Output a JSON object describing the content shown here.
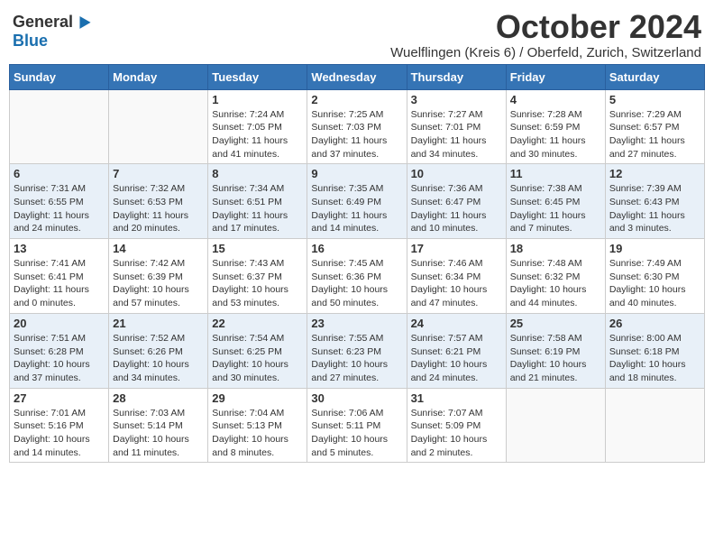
{
  "header": {
    "logo": {
      "general": "General",
      "blue": "Blue"
    },
    "title": "October 2024",
    "subtitle": "Wuelflingen (Kreis 6) / Oberfeld, Zurich, Switzerland"
  },
  "days_of_week": [
    "Sunday",
    "Monday",
    "Tuesday",
    "Wednesday",
    "Thursday",
    "Friday",
    "Saturday"
  ],
  "weeks": [
    [
      {
        "day": null
      },
      {
        "day": null
      },
      {
        "day": "1",
        "sunrise": "Sunrise: 7:24 AM",
        "sunset": "Sunset: 7:05 PM",
        "daylight": "Daylight: 11 hours and 41 minutes."
      },
      {
        "day": "2",
        "sunrise": "Sunrise: 7:25 AM",
        "sunset": "Sunset: 7:03 PM",
        "daylight": "Daylight: 11 hours and 37 minutes."
      },
      {
        "day": "3",
        "sunrise": "Sunrise: 7:27 AM",
        "sunset": "Sunset: 7:01 PM",
        "daylight": "Daylight: 11 hours and 34 minutes."
      },
      {
        "day": "4",
        "sunrise": "Sunrise: 7:28 AM",
        "sunset": "Sunset: 6:59 PM",
        "daylight": "Daylight: 11 hours and 30 minutes."
      },
      {
        "day": "5",
        "sunrise": "Sunrise: 7:29 AM",
        "sunset": "Sunset: 6:57 PM",
        "daylight": "Daylight: 11 hours and 27 minutes."
      }
    ],
    [
      {
        "day": "6",
        "sunrise": "Sunrise: 7:31 AM",
        "sunset": "Sunset: 6:55 PM",
        "daylight": "Daylight: 11 hours and 24 minutes."
      },
      {
        "day": "7",
        "sunrise": "Sunrise: 7:32 AM",
        "sunset": "Sunset: 6:53 PM",
        "daylight": "Daylight: 11 hours and 20 minutes."
      },
      {
        "day": "8",
        "sunrise": "Sunrise: 7:34 AM",
        "sunset": "Sunset: 6:51 PM",
        "daylight": "Daylight: 11 hours and 17 minutes."
      },
      {
        "day": "9",
        "sunrise": "Sunrise: 7:35 AM",
        "sunset": "Sunset: 6:49 PM",
        "daylight": "Daylight: 11 hours and 14 minutes."
      },
      {
        "day": "10",
        "sunrise": "Sunrise: 7:36 AM",
        "sunset": "Sunset: 6:47 PM",
        "daylight": "Daylight: 11 hours and 10 minutes."
      },
      {
        "day": "11",
        "sunrise": "Sunrise: 7:38 AM",
        "sunset": "Sunset: 6:45 PM",
        "daylight": "Daylight: 11 hours and 7 minutes."
      },
      {
        "day": "12",
        "sunrise": "Sunrise: 7:39 AM",
        "sunset": "Sunset: 6:43 PM",
        "daylight": "Daylight: 11 hours and 3 minutes."
      }
    ],
    [
      {
        "day": "13",
        "sunrise": "Sunrise: 7:41 AM",
        "sunset": "Sunset: 6:41 PM",
        "daylight": "Daylight: 11 hours and 0 minutes."
      },
      {
        "day": "14",
        "sunrise": "Sunrise: 7:42 AM",
        "sunset": "Sunset: 6:39 PM",
        "daylight": "Daylight: 10 hours and 57 minutes."
      },
      {
        "day": "15",
        "sunrise": "Sunrise: 7:43 AM",
        "sunset": "Sunset: 6:37 PM",
        "daylight": "Daylight: 10 hours and 53 minutes."
      },
      {
        "day": "16",
        "sunrise": "Sunrise: 7:45 AM",
        "sunset": "Sunset: 6:36 PM",
        "daylight": "Daylight: 10 hours and 50 minutes."
      },
      {
        "day": "17",
        "sunrise": "Sunrise: 7:46 AM",
        "sunset": "Sunset: 6:34 PM",
        "daylight": "Daylight: 10 hours and 47 minutes."
      },
      {
        "day": "18",
        "sunrise": "Sunrise: 7:48 AM",
        "sunset": "Sunset: 6:32 PM",
        "daylight": "Daylight: 10 hours and 44 minutes."
      },
      {
        "day": "19",
        "sunrise": "Sunrise: 7:49 AM",
        "sunset": "Sunset: 6:30 PM",
        "daylight": "Daylight: 10 hours and 40 minutes."
      }
    ],
    [
      {
        "day": "20",
        "sunrise": "Sunrise: 7:51 AM",
        "sunset": "Sunset: 6:28 PM",
        "daylight": "Daylight: 10 hours and 37 minutes."
      },
      {
        "day": "21",
        "sunrise": "Sunrise: 7:52 AM",
        "sunset": "Sunset: 6:26 PM",
        "daylight": "Daylight: 10 hours and 34 minutes."
      },
      {
        "day": "22",
        "sunrise": "Sunrise: 7:54 AM",
        "sunset": "Sunset: 6:25 PM",
        "daylight": "Daylight: 10 hours and 30 minutes."
      },
      {
        "day": "23",
        "sunrise": "Sunrise: 7:55 AM",
        "sunset": "Sunset: 6:23 PM",
        "daylight": "Daylight: 10 hours and 27 minutes."
      },
      {
        "day": "24",
        "sunrise": "Sunrise: 7:57 AM",
        "sunset": "Sunset: 6:21 PM",
        "daylight": "Daylight: 10 hours and 24 minutes."
      },
      {
        "day": "25",
        "sunrise": "Sunrise: 7:58 AM",
        "sunset": "Sunset: 6:19 PM",
        "daylight": "Daylight: 10 hours and 21 minutes."
      },
      {
        "day": "26",
        "sunrise": "Sunrise: 8:00 AM",
        "sunset": "Sunset: 6:18 PM",
        "daylight": "Daylight: 10 hours and 18 minutes."
      }
    ],
    [
      {
        "day": "27",
        "sunrise": "Sunrise: 7:01 AM",
        "sunset": "Sunset: 5:16 PM",
        "daylight": "Daylight: 10 hours and 14 minutes."
      },
      {
        "day": "28",
        "sunrise": "Sunrise: 7:03 AM",
        "sunset": "Sunset: 5:14 PM",
        "daylight": "Daylight: 10 hours and 11 minutes."
      },
      {
        "day": "29",
        "sunrise": "Sunrise: 7:04 AM",
        "sunset": "Sunset: 5:13 PM",
        "daylight": "Daylight: 10 hours and 8 minutes."
      },
      {
        "day": "30",
        "sunrise": "Sunrise: 7:06 AM",
        "sunset": "Sunset: 5:11 PM",
        "daylight": "Daylight: 10 hours and 5 minutes."
      },
      {
        "day": "31",
        "sunrise": "Sunrise: 7:07 AM",
        "sunset": "Sunset: 5:09 PM",
        "daylight": "Daylight: 10 hours and 2 minutes."
      },
      {
        "day": null
      },
      {
        "day": null
      }
    ]
  ]
}
